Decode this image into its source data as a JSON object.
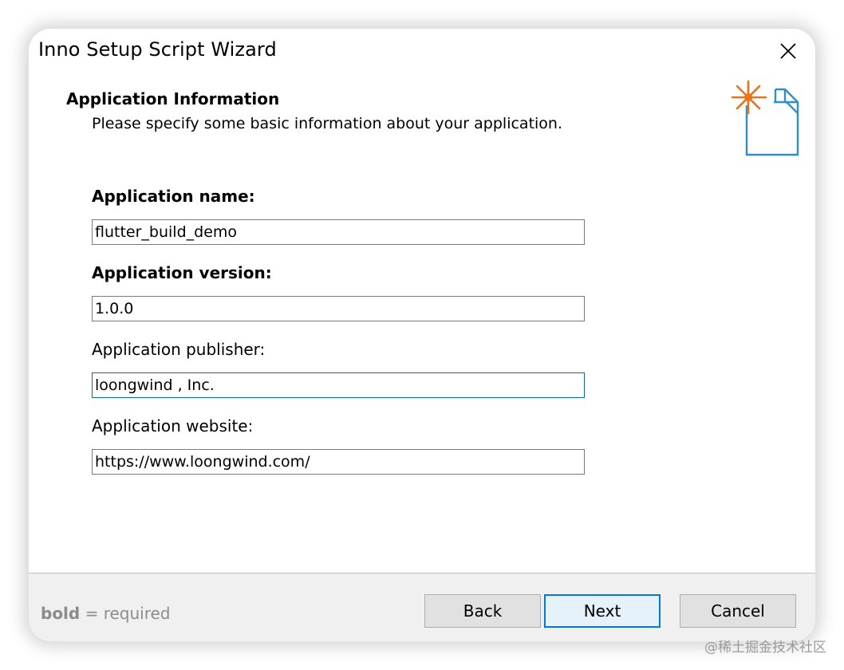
{
  "window": {
    "title": "Inno Setup Script Wizard",
    "close_icon": "close-icon"
  },
  "header": {
    "title": "Application Information",
    "subtitle": "Please specify some basic information about your application.",
    "icon": "new-document-sparkle-icon"
  },
  "fields": [
    {
      "label": "Application name:",
      "value": "flutter_build_demo",
      "required": true
    },
    {
      "label": "Application version:",
      "value": "1.0.0",
      "required": true
    },
    {
      "label": "Application publisher:",
      "value": "loongwind , Inc.",
      "required": false,
      "focused": true
    },
    {
      "label": "Application website:",
      "value": "https://www.loongwind.com/",
      "required": false
    }
  ],
  "footer": {
    "legend_bold": "bold",
    "legend_rest": " = required",
    "back_label": "Back",
    "next_label": "Next",
    "cancel_label": "Cancel"
  },
  "watermark": "@稀土掘金技术社区",
  "colors": {
    "accent": "#0078d7",
    "focus_border": "#0a6e8a",
    "icon_orange": "#e8731a",
    "icon_blue": "#2f8fd0",
    "footer_bg": "#f0f0f0"
  }
}
